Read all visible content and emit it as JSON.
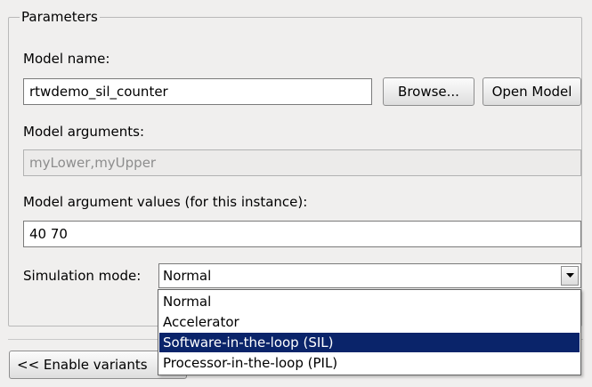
{
  "parameters": {
    "group_title": "Parameters",
    "model_name_label": "Model name:",
    "model_name_value": "rtwdemo_sil_counter",
    "browse_label": "Browse...",
    "open_model_label": "Open Model",
    "model_arguments_label": "Model arguments:",
    "model_arguments_value": "myLower,myUpper",
    "model_argument_values_label": "Model argument values (for this instance):",
    "model_argument_values_value": "40 70",
    "simulation_mode_label": "Simulation mode:",
    "simulation_mode_value": "Normal",
    "simulation_mode_options": [
      "Normal",
      "Accelerator",
      "Software-in-the-loop (SIL)",
      "Processor-in-the-loop (PIL)"
    ],
    "highlighted_option_index": 2
  },
  "footer": {
    "enable_variants_label": "<< Enable variants"
  },
  "colors": {
    "background": "#f0efee",
    "selection": "#0a246a"
  },
  "icons": {
    "combo_arrow": "chevron-down-icon"
  }
}
